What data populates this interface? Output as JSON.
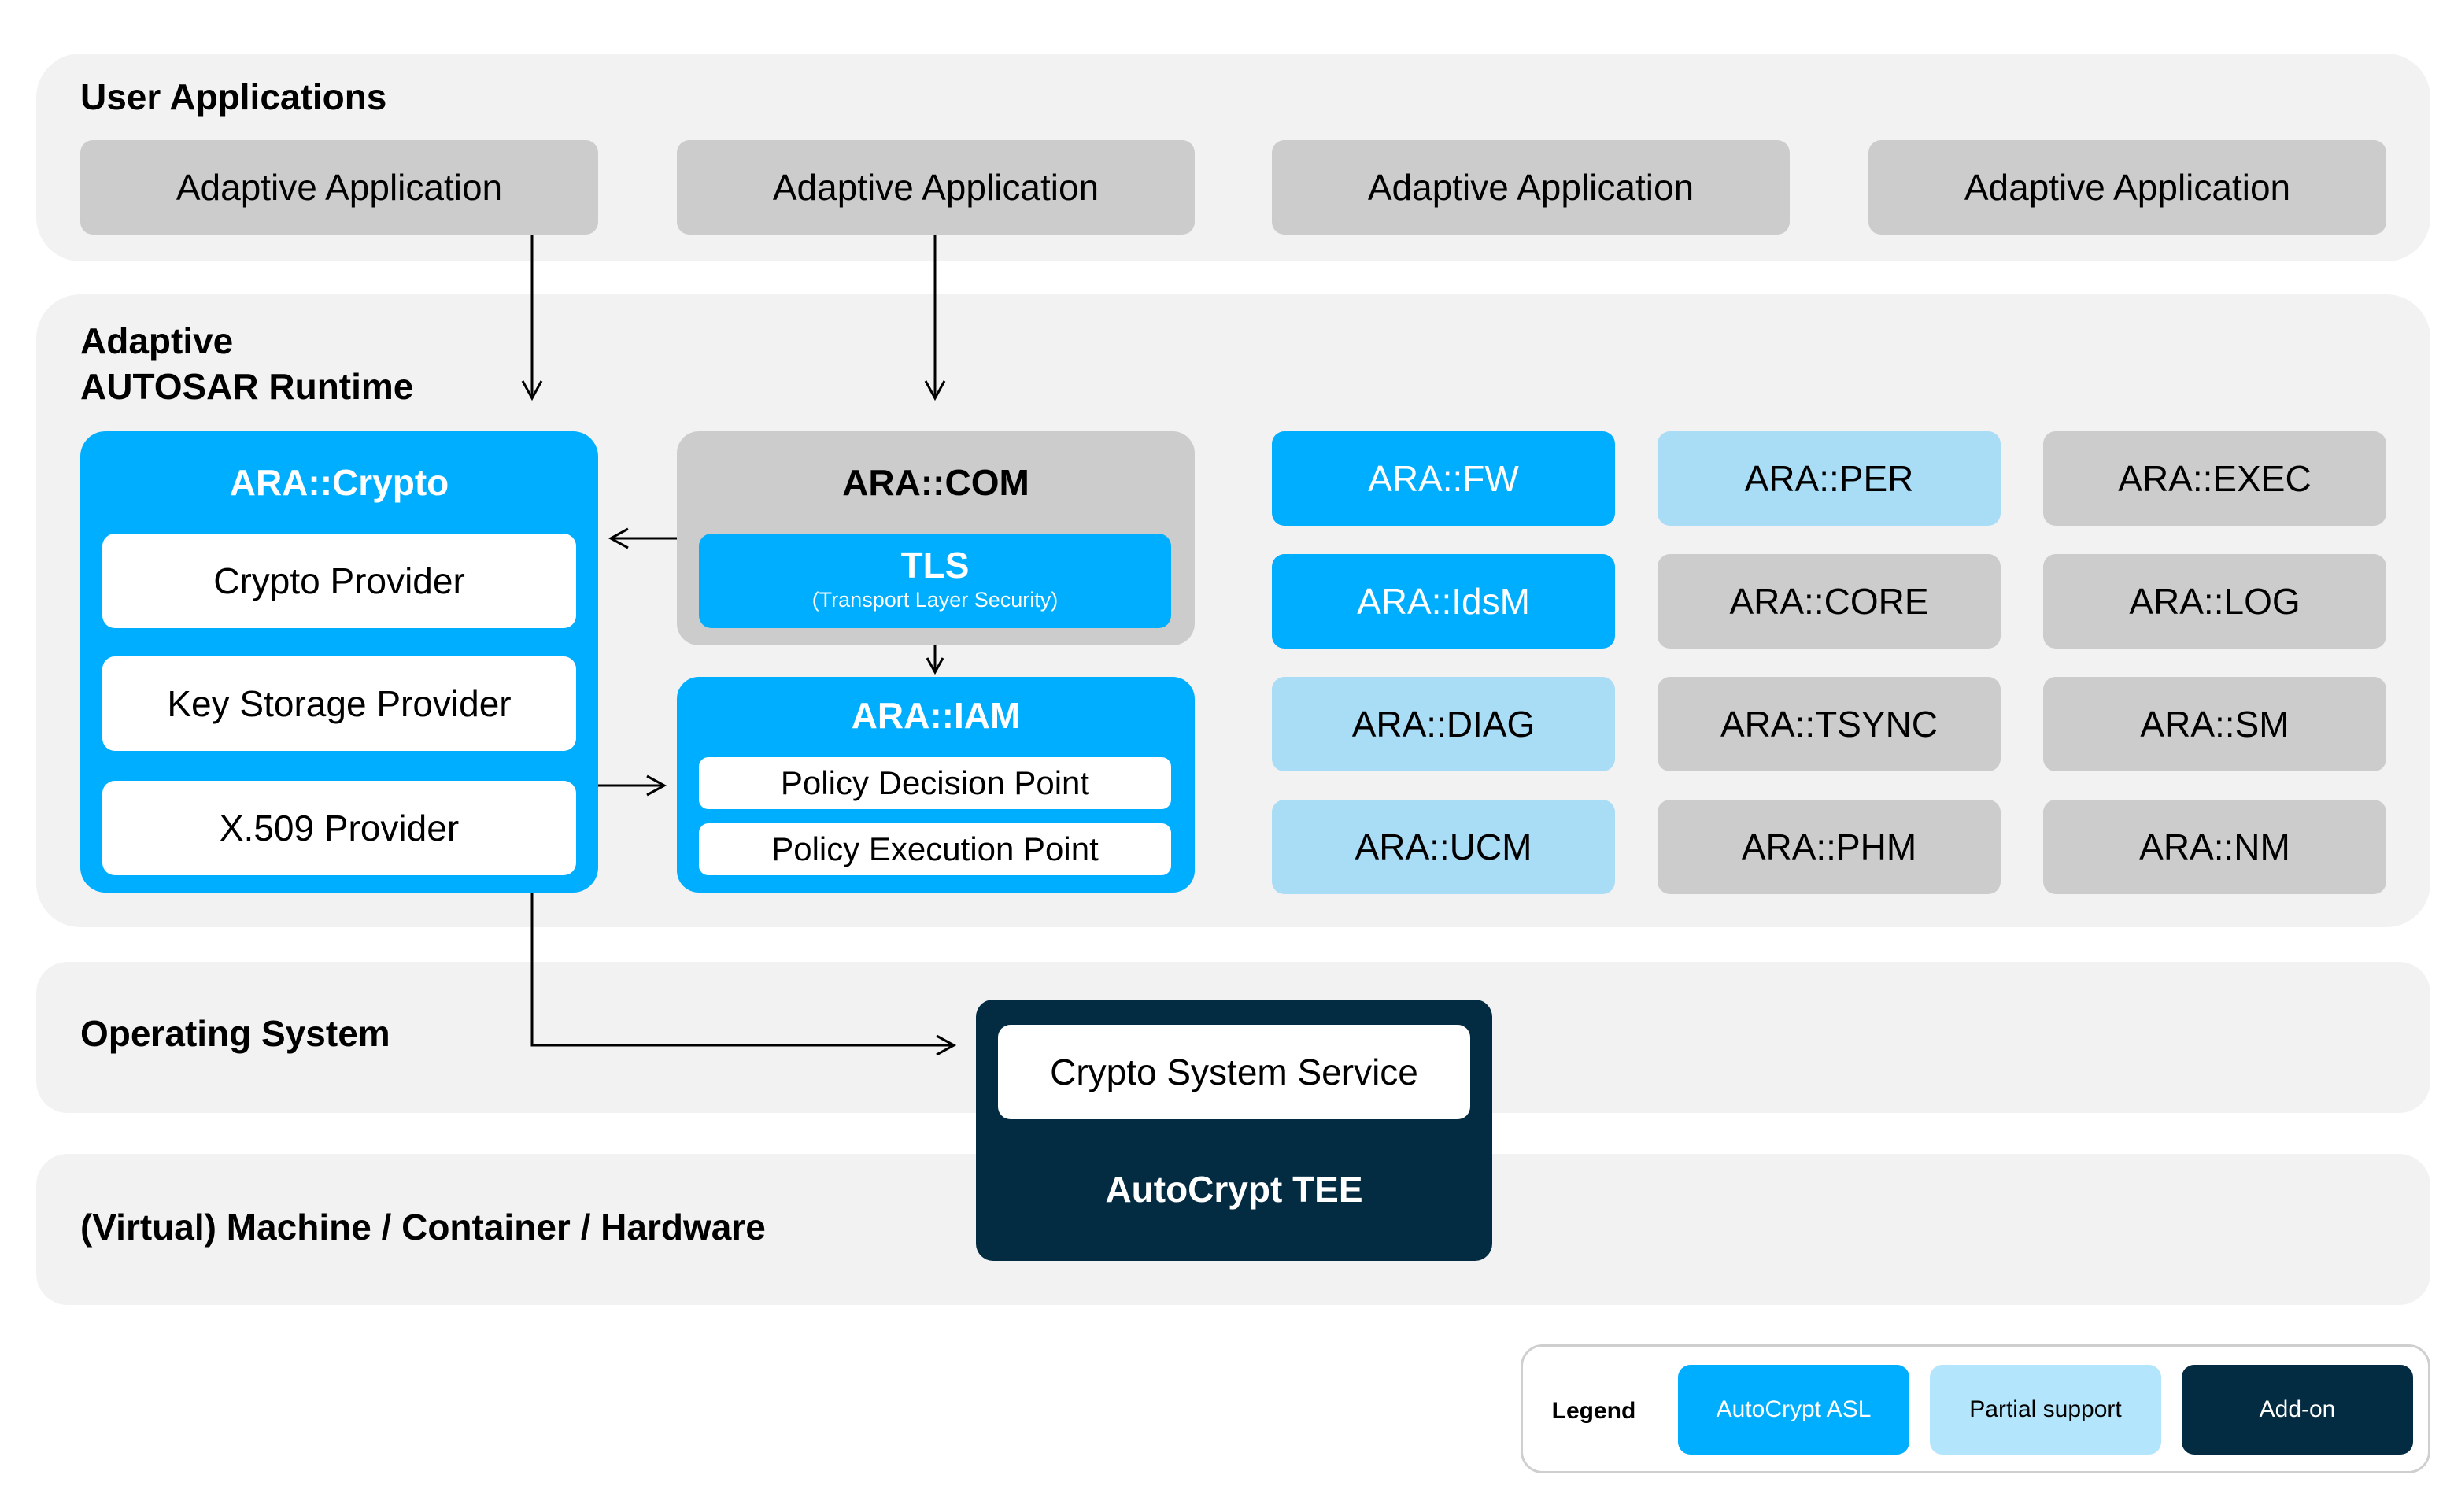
{
  "layers": {
    "user_apps": {
      "title": "User Applications",
      "apps": [
        "Adaptive Application",
        "Adaptive Application",
        "Adaptive Application",
        "Adaptive Application"
      ]
    },
    "runtime": {
      "title_line1": "Adaptive",
      "title_line2": "AUTOSAR Runtime"
    },
    "os": {
      "title": "Operating System"
    },
    "machine": {
      "title": "(Virtual) Machine / Container / Hardware"
    }
  },
  "crypto": {
    "title": "ARA::Crypto",
    "providers": [
      "Crypto Provider",
      "Key Storage Provider",
      "X.509 Provider"
    ]
  },
  "com": {
    "title": "ARA::COM",
    "tls_title": "TLS",
    "tls_subtitle": "(Transport Layer Security)"
  },
  "iam": {
    "title": "ARA::IAM",
    "points": [
      "Policy Decision Point",
      "Policy Execution Point"
    ]
  },
  "modules": [
    {
      "label": "ARA::FW",
      "status": "autocrypt"
    },
    {
      "label": "ARA::PER",
      "status": "partial"
    },
    {
      "label": "ARA::EXEC",
      "status": "none"
    },
    {
      "label": "ARA::IdsM",
      "status": "autocrypt"
    },
    {
      "label": "ARA::CORE",
      "status": "none"
    },
    {
      "label": "ARA::LOG",
      "status": "none"
    },
    {
      "label": "ARA::DIAG",
      "status": "partial"
    },
    {
      "label": "ARA::TSYNC",
      "status": "none"
    },
    {
      "label": "ARA::SM",
      "status": "none"
    },
    {
      "label": "ARA::UCM",
      "status": "partial"
    },
    {
      "label": "ARA::PHM",
      "status": "none"
    },
    {
      "label": "ARA::NM",
      "status": "none"
    }
  ],
  "tee": {
    "service": "Crypto System Service",
    "title": "AutoCrypt TEE"
  },
  "legend": {
    "title": "Legend",
    "items": [
      {
        "label": "AutoCrypt ASL",
        "color": "#00aeff"
      },
      {
        "label": "Partial support",
        "color": "#a9dcf5"
      },
      {
        "label": "Add-on",
        "color": "#032b42"
      }
    ]
  },
  "colors": {
    "autocrypt": "#00aeff",
    "partial": "#a9dcf5",
    "none": "#cccccc",
    "addon": "#032b42",
    "layer_bg": "#f2f2f2"
  }
}
